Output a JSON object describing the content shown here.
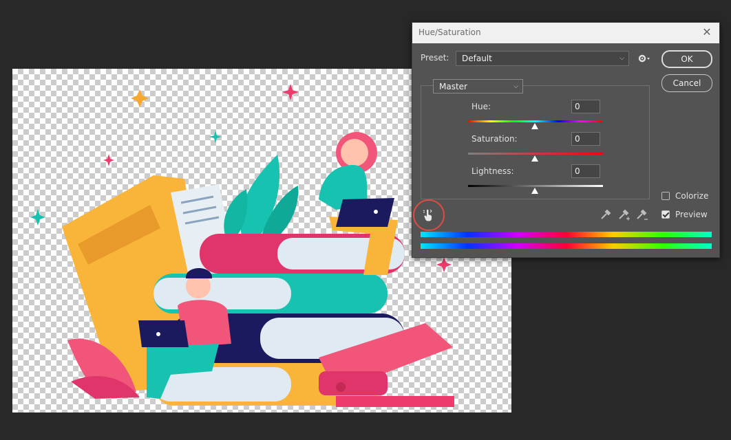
{
  "dialog": {
    "title": "Hue/Saturation",
    "preset_label": "Preset:",
    "preset_value": "Default",
    "ok_label": "OK",
    "cancel_label": "Cancel",
    "channel_value": "Master",
    "hue_label": "Hue:",
    "hue_value": "0",
    "saturation_label": "Saturation:",
    "saturation_value": "0",
    "lightness_label": "Lightness:",
    "lightness_value": "0",
    "colorize_label": "Colorize",
    "colorize_checked": false,
    "preview_label": "Preview",
    "preview_checked": true
  },
  "icons": [
    "close-icon",
    "gear-icon",
    "chevron-down-icon",
    "targeted-adjustment-hand-icon",
    "eyedropper-icon",
    "eyedropper-plus-icon",
    "eyedropper-minus-icon"
  ],
  "colors": {
    "workspace": "#282828",
    "dialog_bg": "#535353",
    "highlight_circle": "#e04b42"
  }
}
